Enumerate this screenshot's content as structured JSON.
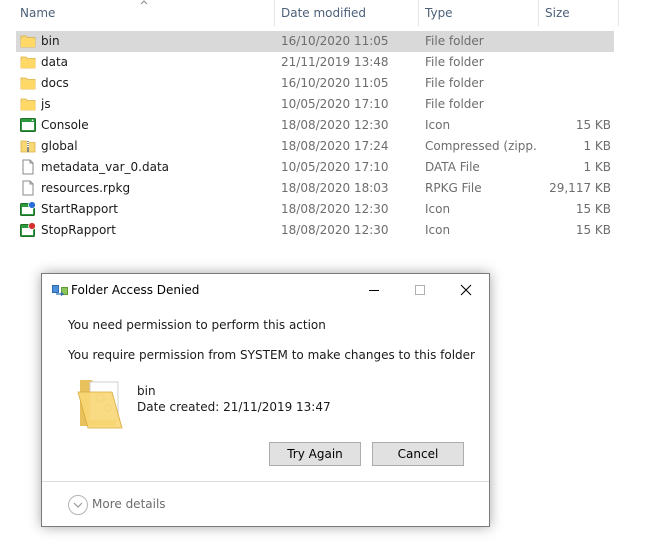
{
  "columns": {
    "name": "Name",
    "date_modified": "Date modified",
    "type": "Type",
    "size": "Size"
  },
  "files": [
    {
      "name": "bin",
      "date": "16/10/2020 11:05",
      "type": "File folder",
      "size": "",
      "icon": "folder-icon",
      "selected": true
    },
    {
      "name": "data",
      "date": "21/11/2019 13:48",
      "type": "File folder",
      "size": "",
      "icon": "folder-icon"
    },
    {
      "name": "docs",
      "date": "16/10/2020 11:05",
      "type": "File folder",
      "size": "",
      "icon": "folder-icon"
    },
    {
      "name": "js",
      "date": "10/05/2020 17:10",
      "type": "File folder",
      "size": "",
      "icon": "folder-icon"
    },
    {
      "name": "Console",
      "date": "18/08/2020 12:30",
      "type": "Icon",
      "size": "15 KB",
      "icon": "console-icon"
    },
    {
      "name": "global",
      "date": "18/08/2020 17:24",
      "type": "Compressed (zipp...",
      "size": "1 KB",
      "icon": "zip-folder-icon"
    },
    {
      "name": "metadata_var_0.data",
      "date": "10/05/2020 17:10",
      "type": "DATA File",
      "size": "1 KB",
      "icon": "file-icon"
    },
    {
      "name": "resources.rpkg",
      "date": "18/08/2020 18:03",
      "type": "RPKG File",
      "size": "29,117 KB",
      "icon": "file-icon"
    },
    {
      "name": "StartRapport",
      "date": "18/08/2020 12:30",
      "type": "Icon",
      "size": "15 KB",
      "icon": "start-app-icon"
    },
    {
      "name": "StopRapport",
      "date": "18/08/2020 12:30",
      "type": "Icon",
      "size": "15 KB",
      "icon": "stop-app-icon"
    }
  ],
  "dialog": {
    "title": "Folder Access Denied",
    "message": "You need permission to perform this action",
    "detail": "You require permission from SYSTEM to make changes to this folder",
    "folder_name": "bin",
    "date_created": "Date created: 21/11/2019 13:47",
    "try_again_label": "Try Again",
    "cancel_label": "Cancel",
    "more_details_label": "More details"
  },
  "colors": {
    "selected_row": "#d9d9d9",
    "folder": "#f8d775",
    "header_text": "#4c607a"
  }
}
